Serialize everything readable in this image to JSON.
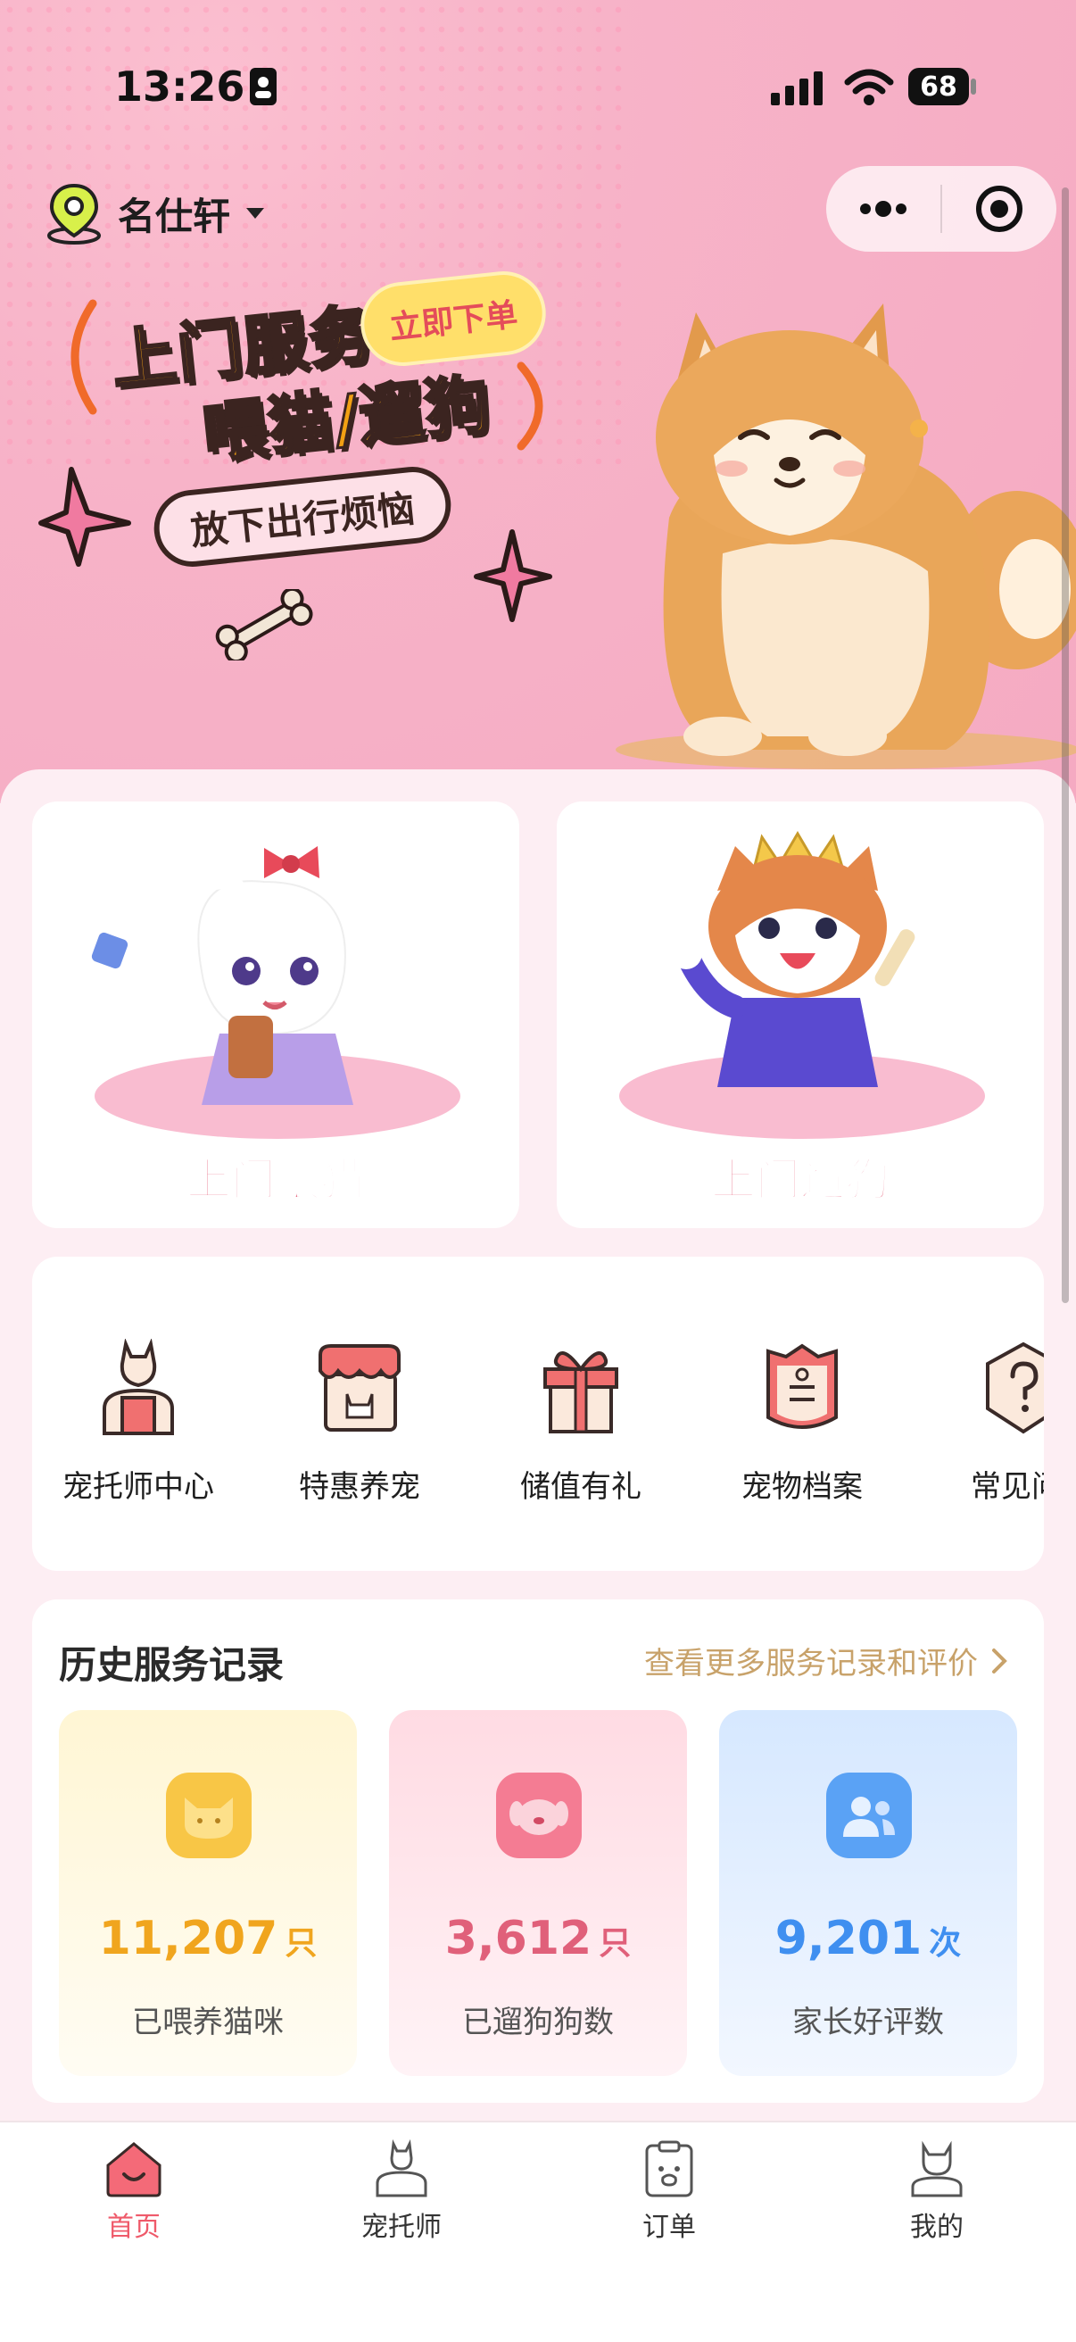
{
  "status_bar": {
    "time": "13:26",
    "battery": "68"
  },
  "header": {
    "location_name": "名仕轩"
  },
  "banner": {
    "headline_1": "上门服务",
    "headline_2": "喂猫/遛狗",
    "badge": "立即下单",
    "tagline": "放下出行烦恼"
  },
  "services": [
    {
      "label": "上门喂猫"
    },
    {
      "label": "上门遛狗"
    }
  ],
  "quick_menu": [
    {
      "label": "宠托师中心",
      "icon": "sitter-icon"
    },
    {
      "label": "特惠养宠",
      "icon": "shop-icon"
    },
    {
      "label": "储值有礼",
      "icon": "gift-icon"
    },
    {
      "label": "宠物档案",
      "icon": "pet-file-icon"
    },
    {
      "label": "常见问",
      "icon": "faq-icon"
    }
  ],
  "history": {
    "title": "历史服务记录",
    "more_link": "查看更多服务记录和评价",
    "stats": [
      {
        "value": "11,207",
        "unit": "只",
        "label": "已喂养猫咪",
        "color": "#f0a51e"
      },
      {
        "value": "3,612",
        "unit": "只",
        "label": "已遛狗狗数",
        "color": "#e0607a"
      },
      {
        "value": "9,201",
        "unit": "次",
        "label": "家长好评数",
        "color": "#3f8ff0"
      }
    ]
  },
  "tabbar": {
    "items": [
      {
        "label": "首页",
        "active": true
      },
      {
        "label": "宠托师",
        "active": false
      },
      {
        "label": "订单",
        "active": false
      },
      {
        "label": "我的",
        "active": false
      }
    ]
  },
  "colors": {
    "accent": "#ef5a6a",
    "hero_pink": "#f7b3c8",
    "page_bg": "#fdeef3"
  }
}
